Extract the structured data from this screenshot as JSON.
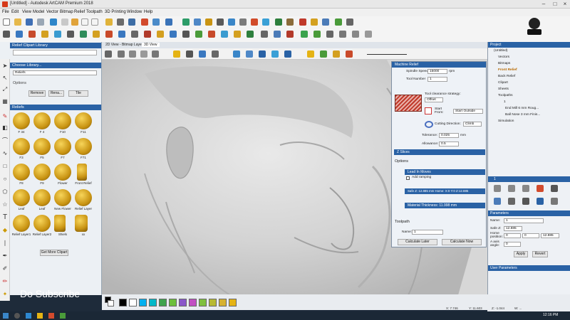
{
  "window": {
    "title": "[Untitled] - Autodesk ArtCAM Premium 2018"
  },
  "menu": [
    "File",
    "Edit",
    "View",
    "Model",
    "Vector",
    "Bitmap",
    "Relief",
    "Toolpath",
    "3D Printing",
    "Window",
    "Help"
  ],
  "view_tabs": {
    "bitmap": "2D View - Bitmap Layer",
    "view3d": "3D View"
  },
  "left_panel": {
    "clipart_header": "Relief Clipart Library",
    "choose_library": "Choose Library...",
    "library_value": "Reliefs",
    "options_label": "Options",
    "remove_btn": "Remove",
    "rename_btn": "Rena...",
    "tile_btn": "Tile",
    "reliefs_header": "Reliefs",
    "items": [
      "F 34",
      "F 4",
      "F10",
      "F11",
      "F3",
      "F5",
      "F7",
      "F71",
      "F8",
      "F9",
      "Flower",
      "Front Relief",
      "Leaf",
      "Leaf",
      "New Flower",
      "Relief Layer",
      "Relief Layer1",
      "Relief Layer2",
      "Shiels",
      "xx"
    ],
    "get_more_btn": "Get More Clipart"
  },
  "overlay_text": "Do Subscribe",
  "machine_relief": {
    "title": "Machine Relief",
    "spindle_label": "Spindle Speed",
    "spindle_value": "15000",
    "spindle_unit": "rpm",
    "toolnum_label": "Tool Number",
    "toolnum_value": "1",
    "clearance_label": "Tool clearance strategy:",
    "clearance_value": "Offset",
    "start_label": "Start From:",
    "start_value": "Start Outside",
    "cutting_label": "Cutting Direction:",
    "cutting_value": "Climb",
    "tolerance_label": "Tolerance:",
    "tolerance_value": "0.025",
    "tolerance_unit": "mm",
    "allowance_label": "Allowance:",
    "allowance_value": "0.5",
    "z_slices": "Z Slices",
    "options": "Options",
    "lead_in": "Lead In Moves",
    "add_ramping": "Add ramping",
    "safe_z": "Safe Z: 12.885 mm  Home: X:0 Y:0 Z:12.885",
    "material": "Material Thickness: 11.998 mm",
    "toolpath_label": "Toolpath",
    "name_label": "Name:",
    "name_value": "1",
    "calc_later": "Calculate Later",
    "calc_now": "Calculate Now"
  },
  "right_panel": {
    "project_header": "Project",
    "tree": [
      "(Untitled)",
      "Vectors",
      "Bitmaps",
      "Front Relief",
      "Back Relief",
      "Clipart",
      "Sheets",
      "Toolpaths",
      "1",
      "End Mill 6 mm Roug...",
      "Ball Nose 3 mm Finis...",
      "Simulation"
    ],
    "toolpath_header": "1",
    "params_header": "Parameters",
    "name_label": "Name:",
    "name_value": "1",
    "safez_label": "Safe Z:",
    "safez_value": "12.885",
    "home_label": "Home position:",
    "home_x": "0",
    "home_y": "0",
    "home_z": "12.885",
    "axis_label": "A axis angle:",
    "axis_value": "0",
    "apply_btn": "Apply",
    "revert_btn": "Revert",
    "user_params": "User Parameters"
  },
  "status": {
    "x": "X: 7.746",
    "y": "Y: 11.603",
    "z": "Z: -1.044",
    "w": "W: ..."
  },
  "clock": "12:16 PM",
  "colors": {
    "accent": "#2a62a5",
    "gold": "#c99413",
    "taskbar": "#1b2836"
  },
  "palette": [
    "#000000",
    "#ffffff",
    "#00b0f0",
    "#00b8c8",
    "#3fa34d",
    "#6cbf3c",
    "#8a57c9",
    "#c14fc2",
    "#7fbf3f",
    "#b7b934",
    "#d6b130",
    "#e5b314"
  ]
}
